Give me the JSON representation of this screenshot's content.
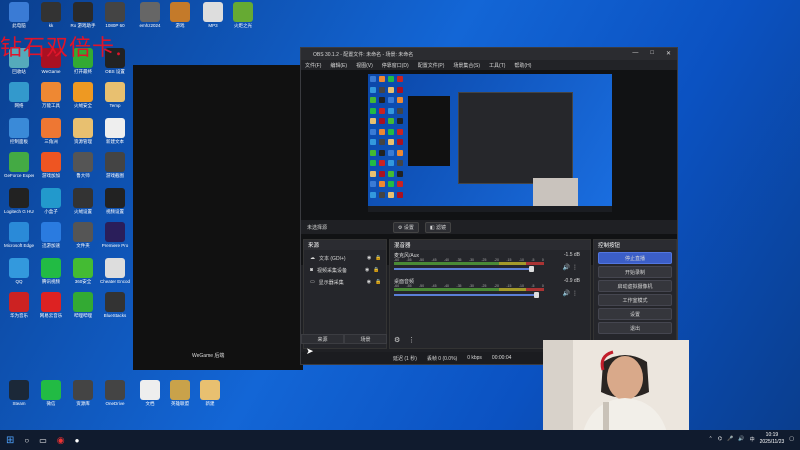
{
  "overlay_text": "钻石双倍卡.",
  "desktop": {
    "icons": [
      {
        "label": "此电脑",
        "color": "#3a7bd5"
      },
      {
        "label": "kk",
        "color": "#333"
      },
      {
        "label": "Ro 游戏助手",
        "color": "#2a2a2a"
      },
      {
        "label": "1080P 60",
        "color": "#444"
      },
      {
        "label": "emhz2024",
        "color": "#666"
      },
      {
        "label": "游戏",
        "color": "#c47a2a"
      },
      {
        "label": "MP3",
        "color": "#ddd"
      },
      {
        "label": "火炬之光",
        "color": "#6a3"
      },
      {
        "label": "回收站",
        "color": "#5ab"
      },
      {
        "label": "WeGame",
        "color": "#a12"
      },
      {
        "label": "打开最终",
        "color": "#3a3"
      },
      {
        "label": "OBS 设置",
        "color": "#222"
      },
      {
        "label": "网络",
        "color": "#39c"
      },
      {
        "label": "万能工具",
        "color": "#e83"
      },
      {
        "label": "火绒安全",
        "color": "#e92"
      },
      {
        "label": "Temp",
        "color": "#e8c070"
      },
      {
        "label": "控制面板",
        "color": "#3a8ad8"
      },
      {
        "label": "三角洲",
        "color": "#e73"
      },
      {
        "label": "资源管理",
        "color": "#e8c070"
      },
      {
        "label": "新建文本",
        "color": "#eee"
      },
      {
        "label": "GeForce Experience",
        "color": "#4a4"
      },
      {
        "label": "游戏加加",
        "color": "#e52"
      },
      {
        "label": "鲁大师",
        "color": "#555"
      },
      {
        "label": "游戏截图",
        "color": "#444"
      },
      {
        "label": "Logitech G HUB",
        "color": "#222"
      },
      {
        "label": "小盒子",
        "color": "#29c"
      },
      {
        "label": "火绒设置",
        "color": "#333"
      },
      {
        "label": "视频设置",
        "color": "#222"
      },
      {
        "label": "Microsoft Edge",
        "color": "#2a8ad8"
      },
      {
        "label": "迅游加速",
        "color": "#2a7be0"
      },
      {
        "label": "文件夹",
        "color": "#555"
      },
      {
        "label": "Premiere Pro",
        "color": "#2a1e5a"
      },
      {
        "label": "QQ",
        "color": "#39d"
      },
      {
        "label": "腾讯视频",
        "color": "#2b4"
      },
      {
        "label": "360安全",
        "color": "#4b3"
      },
      {
        "label": "Cheater Encoding",
        "color": "#ddd"
      },
      {
        "label": "华为音乐",
        "color": "#c22"
      },
      {
        "label": "网易云音乐",
        "color": "#d22"
      },
      {
        "label": "哔哩哔哩",
        "color": "#3a3"
      },
      {
        "label": "BlueStacks",
        "color": "#333"
      },
      {
        "label": "Steam",
        "color": "#1b2838"
      },
      {
        "label": "微信",
        "color": "#2b4"
      },
      {
        "label": "资源库",
        "color": "#444"
      },
      {
        "label": "OneDrive",
        "color": "#444"
      },
      {
        "label": "文档",
        "color": "#eee"
      },
      {
        "label": "英雄联盟",
        "color": "#c9a24a"
      },
      {
        "label": "新建",
        "color": "#e8c070"
      }
    ],
    "black_panel_caption": "WeGame 后端"
  },
  "obs": {
    "title": "OBS 30.1.2 - 配置文件: 未命名 - 场景: 未命名",
    "window_controls": [
      "—",
      "□",
      "✕"
    ],
    "menu": [
      "文件(F)",
      "编辑(E)",
      "视图(V)",
      "停靠窗口(D)",
      "配置文件(P)",
      "场景集合(S)",
      "工具(T)",
      "帮助(H)"
    ],
    "toolbar": {
      "scene_status": "未选择源",
      "settings": "设置",
      "filters": "滤镜"
    },
    "sources": {
      "title": "来源",
      "items": [
        {
          "icon": "text-icon",
          "label": "文本 (GDI+)"
        },
        {
          "icon": "camera-icon",
          "label": "视频采集设备"
        },
        {
          "icon": "display-icon",
          "label": "显示器采集"
        }
      ]
    },
    "tabs": {
      "sources": "来源",
      "scenes": "场景"
    },
    "mixer": {
      "title": "混音器",
      "ticks": [
        "-60",
        "-55",
        "-50",
        "-45",
        "-40",
        "-35",
        "-30",
        "-25",
        "-20",
        "-15",
        "-10",
        "-5",
        "0"
      ],
      "channels": [
        {
          "name": "麦克风/Aux",
          "db": "-1.5 dB",
          "level": 0.92
        },
        {
          "name": "桌面音频",
          "db": "-0.9 dB",
          "level": 0.95
        }
      ]
    },
    "controls": {
      "title": "控制按钮",
      "buttons": [
        "停止直播",
        "开始录制",
        "启动虚拟摄像机",
        "工作室模式",
        "设置",
        "退出"
      ]
    },
    "status": {
      "dropped": "延迟 (1 秒)",
      "frames": "丢帧 0 (0.0%)",
      "bitrate": "0 kbps",
      "time": "00:00:04"
    }
  },
  "taskbar": {
    "tray_lang": "中",
    "clock": {
      "time": "10:19",
      "date": "2025/11/23"
    }
  },
  "colors": {
    "accent": "#3b5ec7",
    "obs_bg": "#1f2024",
    "overlay_red": "#e0142a"
  }
}
